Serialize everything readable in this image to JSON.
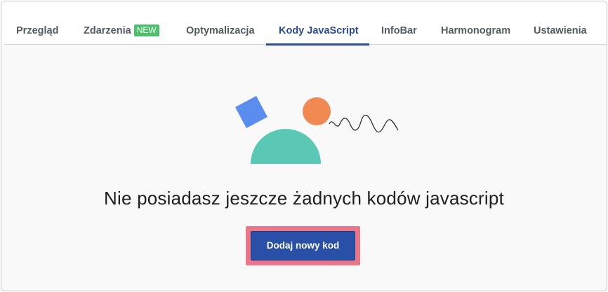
{
  "tabs": [
    {
      "label": "Przegląd",
      "active": false
    },
    {
      "label": "Zdarzenia",
      "badge": "NEW",
      "active": false
    },
    {
      "label": "Optymalizacja",
      "active": false
    },
    {
      "label": "Kody JavaScript",
      "active": true
    },
    {
      "label": "InfoBar",
      "active": false
    },
    {
      "label": "Harmonogram",
      "active": false
    },
    {
      "label": "Ustawienia",
      "active": false
    }
  ],
  "empty_state": {
    "message": "Nie posiadasz jeszcze żadnych kodów javascript",
    "button_label": "Dodaj nowy kod",
    "illustration": "shapes-illustration"
  },
  "colors": {
    "accent": "#2b4c8e",
    "button": "#2a4fa6",
    "highlight": "#e8778b",
    "badge": "#4cbf6b",
    "square": "#5b8def",
    "circle": "#f08a52",
    "semicircle": "#5bc8b5"
  }
}
